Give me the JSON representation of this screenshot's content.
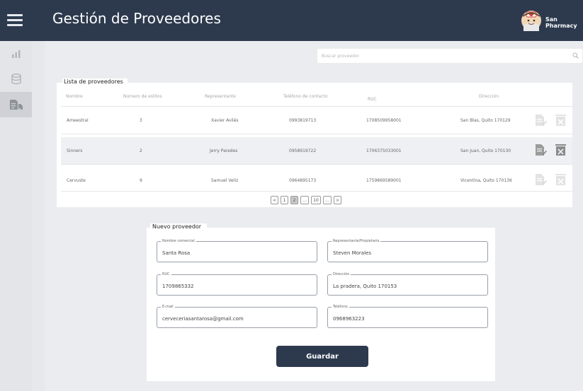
{
  "header": {
    "title": "Gestión de Proveedores",
    "user": "San Pharmacy"
  },
  "search": {
    "placeholder": "Buscar proveedor"
  },
  "list": {
    "title": "Lista de proveedores",
    "columns": [
      "Nombre",
      "Número de estilos",
      "Representante",
      "Teléfono de contacto",
      "RUC",
      "Dirección"
    ],
    "rows": [
      {
        "nombre": "Ameestral",
        "estilos": "3",
        "representante": "Xavier Avilés",
        "telefono": "0993819713",
        "ruc": "1708509958001",
        "direccion": "San Blas, Quito 170129"
      },
      {
        "nombre": "Sinners",
        "estilos": "2",
        "representante": "Jerry Paredes",
        "telefono": "0958919722",
        "ruc": "1706375033001",
        "direccion": "San Juan, Quito 170130"
      },
      {
        "nombre": "Cervuste",
        "estilos": "9",
        "representante": "Samuel Veliz",
        "telefono": "0964895173",
        "ruc": "1759869589001",
        "direccion": "Vicentina, Quito 170136"
      }
    ],
    "selected_row": 1
  },
  "pagination": {
    "prev": "<",
    "pages": [
      "1",
      "2",
      "...",
      "10",
      "..."
    ],
    "current": "2",
    "next": ">"
  },
  "form": {
    "title": "Nuevo proveedor",
    "fields": [
      {
        "label": "Nombre comercial",
        "value": "Santa Rosa"
      },
      {
        "label": "Representante/Propietario",
        "value": "Steven Morales"
      },
      {
        "label": "RUC",
        "value": "1709865332"
      },
      {
        "label": "Dirección",
        "value": "La pradera, Quito 170153"
      },
      {
        "label": "E-mail",
        "value": "cerveceriasantarosa@gmail.com"
      },
      {
        "label": "Teléfono",
        "value": "0968963223"
      }
    ],
    "save_label": "Guardar"
  },
  "colors": {
    "topbar": "#2d3a4e",
    "background": "#e7e8eb",
    "panel": "#ffffff",
    "selected_row": "#eef0f3",
    "button": "#2d3a4e"
  },
  "icons": {
    "menu": "hamburger-icon",
    "sidebar": [
      "chart-icon",
      "database-icon",
      "supplier-document-icon"
    ],
    "row_actions": [
      "edit-document-icon",
      "delete-icon"
    ],
    "search": "search-icon"
  }
}
